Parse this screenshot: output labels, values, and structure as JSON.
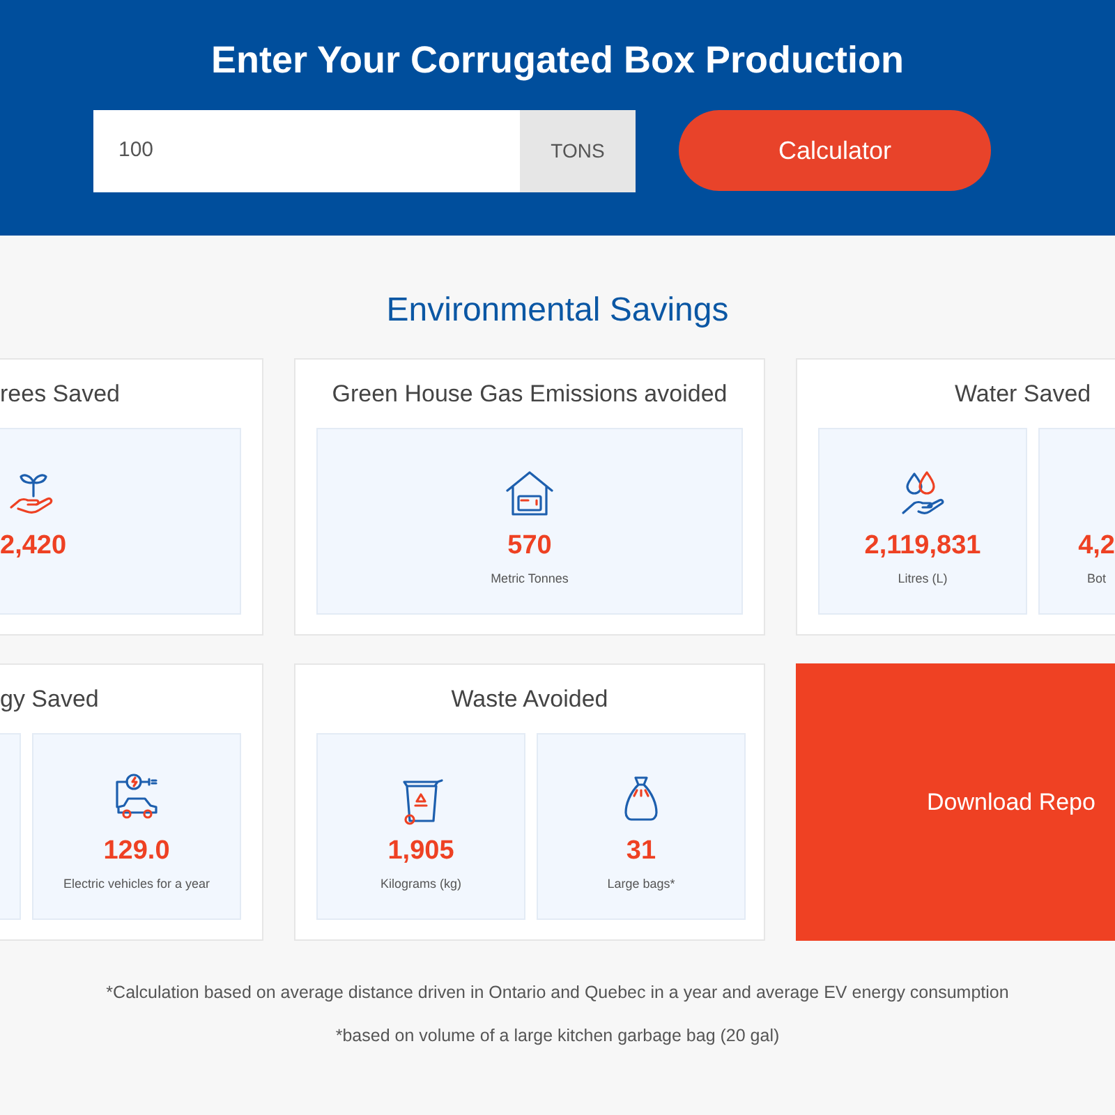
{
  "header": {
    "title": "Enter Your Corrugated Box Production",
    "input": {
      "value": "100",
      "unit": "TONS"
    },
    "button": "Calculator"
  },
  "section_title": "Environmental Savings",
  "cards": [
    {
      "kind": "stats",
      "title": "rees Saved",
      "stats": [
        {
          "kind": "plant",
          "value": "2,420"
        }
      ]
    },
    {
      "kind": "stats",
      "title": "Green House Gas Emissions avoided",
      "stats": [
        {
          "kind": "house",
          "value": "570",
          "label": "Metric Tonnes"
        }
      ]
    },
    {
      "kind": "stats",
      "title": "Water Saved",
      "stats": [
        {
          "kind": "water",
          "value": "2,119,831",
          "label": "Litres (L)"
        },
        {
          "kind": "partial",
          "value": "4,2",
          "label": "Bot"
        }
      ]
    },
    {
      "kind": "stats",
      "title": "gy Saved",
      "stats": [
        {
          "kind": "blank"
        },
        {
          "kind": "car",
          "value": "129.0",
          "label": "Electric vehicles for a year"
        }
      ]
    },
    {
      "kind": "stats",
      "title": "Waste Avoided",
      "stats": [
        {
          "kind": "bin",
          "value": "1,905",
          "label": "Kilograms (kg)"
        },
        {
          "kind": "bag",
          "value": "31",
          "label": "Large bags*"
        }
      ]
    },
    {
      "kind": "button",
      "label": "Download Repo"
    }
  ],
  "footnotes": [
    "*Calculation based on average distance driven in Ontario and Quebec in a year and average EV energy consumption",
    "*based on volume of a large kitchen garbage bag (20 gal)"
  ]
}
